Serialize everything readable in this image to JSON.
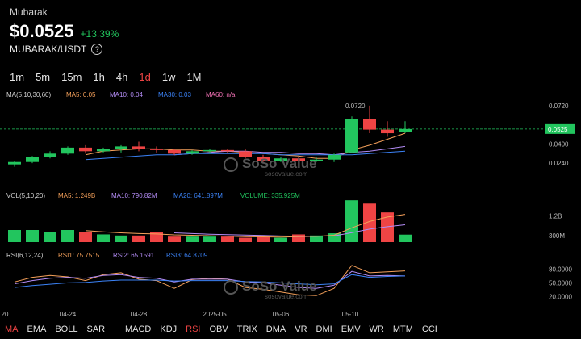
{
  "header": {
    "token_name": "Mubarak",
    "price": "$0.0525",
    "change": "+13.39%",
    "pair": "MUBARAK/USDT",
    "info_icon": "info-icon"
  },
  "timeframes": [
    {
      "label": "1m",
      "active": false
    },
    {
      "label": "5m",
      "active": false
    },
    {
      "label": "15m",
      "active": false
    },
    {
      "label": "1h",
      "active": false
    },
    {
      "label": "4h",
      "active": false
    },
    {
      "label": "1d",
      "active": true
    },
    {
      "label": "1w",
      "active": false
    },
    {
      "label": "1M",
      "active": false
    }
  ],
  "indicators": [
    {
      "label": "MA",
      "active": true
    },
    {
      "label": "EMA",
      "active": false
    },
    {
      "label": "BOLL",
      "active": false
    },
    {
      "label": "SAR",
      "active": false
    },
    {
      "label": "|",
      "separator": true
    },
    {
      "label": "MACD",
      "active": false
    },
    {
      "label": "KDJ",
      "active": false
    },
    {
      "label": "RSI",
      "active": true
    },
    {
      "label": "OBV",
      "active": false
    },
    {
      "label": "TRIX",
      "active": false
    },
    {
      "label": "DMA",
      "active": false
    },
    {
      "label": "VR",
      "active": false
    },
    {
      "label": "DMI",
      "active": false
    },
    {
      "label": "EMV",
      "active": false
    },
    {
      "label": "WR",
      "active": false
    },
    {
      "label": "MTM",
      "active": false
    },
    {
      "label": "CCI",
      "active": false
    }
  ],
  "watermark": {
    "brand": "SoSo Value",
    "url": "sosovalue.com"
  },
  "colors": {
    "up": "#22c55e",
    "down": "#ef4444",
    "ma5": "#f5a05a",
    "ma10": "#b38cf5",
    "ma30": "#3b82f6",
    "ma60": "#f472b6",
    "rsi1": "#f5a05a",
    "rsi2": "#b38cf5",
    "rsi3": "#3b82f6",
    "current_line": "#22c55e"
  },
  "chart_data": {
    "type": "candlestick",
    "x_ticks": [
      "20",
      "04-24",
      "04-28",
      "2025-05",
      "05-06",
      "05-10"
    ],
    "price_axis": {
      "ticks": [
        "0.0720",
        "0.0400",
        "0.0240"
      ],
      "range": [
        0.012,
        0.078
      ],
      "current": "0.0525",
      "max_label": "0.0720"
    },
    "candles": [
      {
        "o": 0.023,
        "h": 0.026,
        "l": 0.021,
        "c": 0.025
      },
      {
        "o": 0.025,
        "h": 0.03,
        "l": 0.024,
        "c": 0.029
      },
      {
        "o": 0.029,
        "h": 0.034,
        "l": 0.028,
        "c": 0.032
      },
      {
        "o": 0.032,
        "h": 0.038,
        "l": 0.031,
        "c": 0.037
      },
      {
        "o": 0.037,
        "h": 0.039,
        "l": 0.032,
        "c": 0.034
      },
      {
        "o": 0.034,
        "h": 0.037,
        "l": 0.033,
        "c": 0.036
      },
      {
        "o": 0.036,
        "h": 0.039,
        "l": 0.033,
        "c": 0.038
      },
      {
        "o": 0.038,
        "h": 0.042,
        "l": 0.034,
        "c": 0.036
      },
      {
        "o": 0.036,
        "h": 0.038,
        "l": 0.033,
        "c": 0.035
      },
      {
        "o": 0.035,
        "h": 0.036,
        "l": 0.031,
        "c": 0.032
      },
      {
        "o": 0.032,
        "h": 0.035,
        "l": 0.031,
        "c": 0.034
      },
      {
        "o": 0.034,
        "h": 0.036,
        "l": 0.032,
        "c": 0.035
      },
      {
        "o": 0.035,
        "h": 0.036,
        "l": 0.032,
        "c": 0.034
      },
      {
        "o": 0.034,
        "h": 0.036,
        "l": 0.028,
        "c": 0.029
      },
      {
        "o": 0.029,
        "h": 0.031,
        "l": 0.025,
        "c": 0.026
      },
      {
        "o": 0.026,
        "h": 0.029,
        "l": 0.025,
        "c": 0.028
      },
      {
        "o": 0.028,
        "h": 0.029,
        "l": 0.025,
        "c": 0.026
      },
      {
        "o": 0.026,
        "h": 0.029,
        "l": 0.025,
        "c": 0.027
      },
      {
        "o": 0.027,
        "h": 0.032,
        "l": 0.025,
        "c": 0.031
      },
      {
        "o": 0.033,
        "h": 0.063,
        "l": 0.033,
        "c": 0.061
      },
      {
        "o": 0.061,
        "h": 0.072,
        "l": 0.049,
        "c": 0.052
      },
      {
        "o": 0.052,
        "h": 0.059,
        "l": 0.046,
        "c": 0.049
      },
      {
        "o": 0.05,
        "h": 0.059,
        "l": 0.049,
        "c": 0.0525
      }
    ],
    "ma_series": [
      {
        "name": "MA5",
        "color_key": "ma5",
        "values": [
          null,
          null,
          null,
          null,
          0.031,
          0.034,
          0.035,
          0.036,
          0.036,
          0.035,
          0.035,
          0.034,
          0.034,
          0.033,
          0.032,
          0.031,
          0.03,
          0.028,
          0.028,
          0.035,
          0.039,
          0.044,
          0.049
        ]
      },
      {
        "name": "MA10",
        "color_key": "ma10",
        "values": [
          null,
          null,
          null,
          null,
          null,
          null,
          null,
          null,
          null,
          0.031,
          0.032,
          0.033,
          0.034,
          0.034,
          0.033,
          0.033,
          0.032,
          0.032,
          0.031,
          0.033,
          0.034,
          0.036,
          0.038
        ]
      },
      {
        "name": "MA30",
        "color_key": "ma30",
        "values": [
          null,
          null,
          null,
          null,
          0.027,
          0.028,
          0.029,
          0.03,
          0.031,
          0.031,
          0.032,
          0.032,
          0.032,
          0.032,
          0.032,
          0.031,
          0.031,
          0.031,
          0.031,
          0.031,
          0.032,
          0.033,
          0.034
        ]
      }
    ],
    "legend": {
      "title": "MA(5,10,30,60)",
      "items": [
        {
          "label": "MA5: 0.05",
          "color_key": "ma5"
        },
        {
          "label": "MA10: 0.04",
          "color_key": "ma10"
        },
        {
          "label": "MA30: 0.03",
          "color_key": "ma30"
        },
        {
          "label": "MA60: n/a",
          "color_key": "ma60"
        }
      ]
    },
    "volume": {
      "title": "VOL(5,10,20)",
      "legend": [
        {
          "label": "MA5: 1.249B",
          "color_key": "ma5"
        },
        {
          "label": "MA10: 790.82M",
          "color_key": "ma10"
        },
        {
          "label": "MA20: 641.897M",
          "color_key": "ma30"
        },
        {
          "label": "VOLUME: 335.925M",
          "color": "#22c55e"
        }
      ],
      "axis": [
        "1.2B",
        "300M"
      ],
      "range": [
        0,
        2.2
      ],
      "values": [
        0.55,
        0.55,
        0.45,
        0.55,
        0.45,
        0.35,
        0.3,
        0.3,
        0.45,
        0.25,
        0.25,
        0.25,
        0.25,
        0.2,
        0.25,
        0.2,
        0.35,
        0.3,
        0.4,
        1.9,
        1.75,
        1.35,
        0.34
      ],
      "ma5": [
        null,
        null,
        null,
        null,
        0.52,
        0.47,
        0.42,
        0.39,
        0.37,
        0.33,
        0.31,
        0.29,
        0.27,
        0.25,
        0.24,
        0.23,
        0.25,
        0.26,
        0.31,
        0.65,
        0.94,
        1.14,
        1.26
      ],
      "ma10": [
        null,
        null,
        null,
        null,
        null,
        null,
        null,
        null,
        null,
        0.42,
        0.39,
        0.36,
        0.34,
        0.32,
        0.3,
        0.28,
        0.27,
        0.27,
        0.28,
        0.43,
        0.59,
        0.7,
        0.79
      ]
    },
    "rsi": {
      "title": "RSI(6,12,24)",
      "legend": [
        {
          "label": "RSI1: 75.7515",
          "color_key": "rsi1"
        },
        {
          "label": "RSI2: 65.1591",
          "color_key": "rsi2"
        },
        {
          "label": "RSI3: 64.8709",
          "color_key": "rsi3"
        }
      ],
      "axis": [
        "80.0000",
        "50.0000",
        "20.0000"
      ],
      "range": [
        5,
        100
      ],
      "rsi1": [
        52,
        62,
        66,
        63,
        55,
        68,
        72,
        58,
        55,
        38,
        57,
        60,
        58,
        40,
        36,
        30,
        24,
        22,
        38,
        88,
        72,
        74,
        76
      ],
      "rsi2": [
        48,
        55,
        60,
        62,
        60,
        66,
        68,
        62,
        60,
        52,
        58,
        58,
        58,
        52,
        50,
        45,
        40,
        38,
        45,
        75,
        65,
        66,
        65
      ],
      "rsi3": [
        40,
        44,
        47,
        50,
        51,
        54,
        56,
        56,
        56,
        54,
        55,
        55,
        55,
        53,
        52,
        50,
        48,
        46,
        48,
        68,
        62,
        64,
        65
      ]
    }
  }
}
